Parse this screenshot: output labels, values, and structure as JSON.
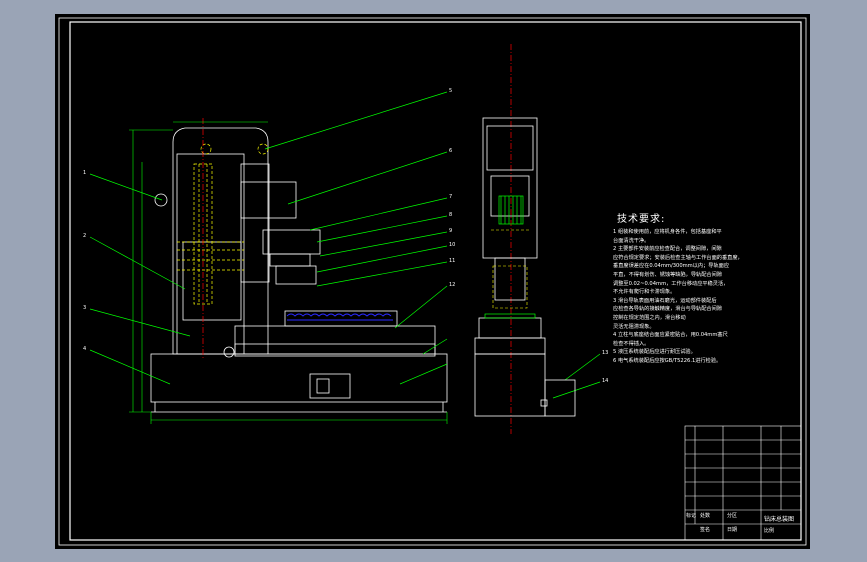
{
  "notes": {
    "title": "技术要求:",
    "lines": [
      "1  组装和使用前，应将机身各件，包括基座和平",
      "   台面清洗干净。",
      "2  主要部件安装前应检查配合，调整间隙，间隙",
      "   应符合规定要求；安装后检查主轴与工作台面的垂直度，",
      "   垂直度误差应在0.04mm/300mm以内；导轨面应",
      "   平直，不得有划伤、锈蚀等缺陷，导轨配合间隙",
      "   调整至0.02~0.04mm，工作台移动应平稳灵活，",
      "   不允许有爬行和卡滞现象。",
      "3  滑台导轨表面用油石磨光，运动部件装配后",
      "   应检查各导轨的接触精度，滑台与导轨配合间隙",
      "   控制在规定范围之内，滑台移动",
      "   灵活无阻滞现象。",
      "4  立柱与底座结合面应紧密贴合，用0.04mm塞尺",
      "   检查不得插入。",
      "5  液压系统装配后应进行耐压试验。",
      "6  电气系统装配后应按GB/T5226.1进行检验。"
    ]
  },
  "balloons": [
    "1",
    "2",
    "3",
    "4",
    "5",
    "6",
    "7",
    "8",
    "9",
    "10",
    "11",
    "12",
    "13",
    "14"
  ],
  "title_block": {
    "row_labels": [
      "标记",
      "处数",
      "分区",
      "更改文件号",
      "签名",
      "日期"
    ],
    "caption": "钻床总装图",
    "scale_label": "比例"
  },
  "colors": {
    "background": "#000000",
    "frame": "#ffffff",
    "leaders": "#00ff00",
    "outline": "#ffffff",
    "dimension": "#00ff00",
    "hidden": "#ffff00",
    "centerline": "#ff0000",
    "parts": "#2a2aff"
  }
}
